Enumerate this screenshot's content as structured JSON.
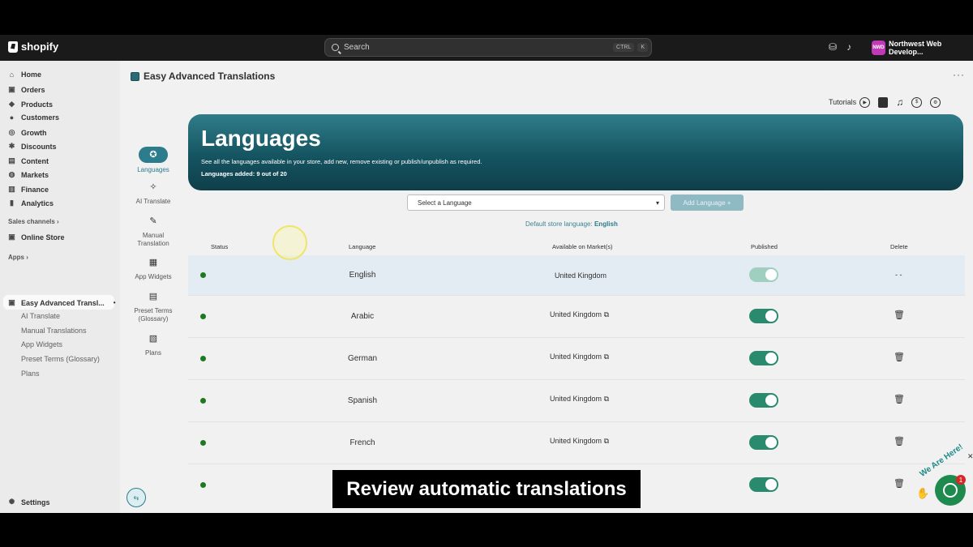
{
  "topbar": {
    "brand": "shopify",
    "search_placeholder": "Search",
    "shortcut_ctrl": "CTRL",
    "shortcut_key": "K",
    "store_initials": "NWD",
    "store_name": "Northwest Web Develop..."
  },
  "sidebar": {
    "items": [
      {
        "label": "Home",
        "icon": "home-icon",
        "glyph": "⌂"
      },
      {
        "label": "Orders",
        "icon": "orders-icon",
        "glyph": "▣"
      },
      {
        "label": "Products",
        "icon": "tag-icon",
        "glyph": "◆"
      },
      {
        "label": "Customers",
        "icon": "person-icon",
        "glyph": "●"
      },
      {
        "label": "Growth",
        "icon": "growth-icon",
        "glyph": "◎"
      },
      {
        "label": "Discounts",
        "icon": "discount-icon",
        "glyph": "✱"
      },
      {
        "label": "Content",
        "icon": "content-icon",
        "glyph": "▤"
      },
      {
        "label": "Markets",
        "icon": "globe-icon",
        "glyph": "◍"
      },
      {
        "label": "Finance",
        "icon": "finance-icon",
        "glyph": "▥"
      },
      {
        "label": "Analytics",
        "icon": "chart-icon",
        "glyph": "▮"
      }
    ],
    "sales_channels_label": "Sales channels",
    "online_store_label": "Online Store",
    "apps_label": "Apps",
    "active_app_label": "Easy Advanced Transl...",
    "app_sub_items": [
      "AI Translate",
      "Manual Translations",
      "App Widgets",
      "Preset Terms (Glossary)",
      "Plans"
    ],
    "settings_label": "Settings"
  },
  "app": {
    "title": "Easy Advanced Translations",
    "tutorials_label": "Tutorials"
  },
  "inner_nav": [
    {
      "label": "Languages",
      "glyph": "✪"
    },
    {
      "label": "AI Translate",
      "glyph": "✧"
    },
    {
      "label": "Manual Translation",
      "glyph": "✎"
    },
    {
      "label": "App Widgets",
      "glyph": "▦"
    },
    {
      "label": "Preset Terms (Glossary)",
      "glyph": "▤"
    },
    {
      "label": "Plans",
      "glyph": "▧"
    }
  ],
  "banner": {
    "title": "Languages",
    "description": "See all the languages available in your store, add new, remove existing or publish/unpublish as required.",
    "count": "Languages added: 9 out of 20"
  },
  "controls": {
    "select_placeholder": "Select a Language",
    "add_button": "Add Language +",
    "default_prefix": "Default store language:",
    "default_value": "English"
  },
  "table": {
    "headers": {
      "status": "Status",
      "language": "Language",
      "market": "Available on Market(s)",
      "published": "Published",
      "delete": "Delete"
    },
    "rows": [
      {
        "language": "English",
        "market": "United Kingdom",
        "published": true,
        "delete": "- -"
      },
      {
        "language": "Arabic",
        "market": "United Kingdom",
        "published": true
      },
      {
        "language": "German",
        "market": "United Kingdom",
        "published": true
      },
      {
        "language": "Spanish",
        "market": "United Kingdom",
        "published": true
      },
      {
        "language": "French",
        "market": "United Kingdom",
        "published": true
      },
      {
        "language": "",
        "market": "",
        "published": true
      }
    ]
  },
  "caption": "Review automatic translations",
  "chat": {
    "label": "We Are Here!",
    "badge": "1"
  },
  "colors": {
    "accent": "#2b7c8c",
    "banner_dark": "#0f3f4a",
    "toggle_on": "#2a8a6e",
    "status_dot": "#1f7a1f"
  }
}
